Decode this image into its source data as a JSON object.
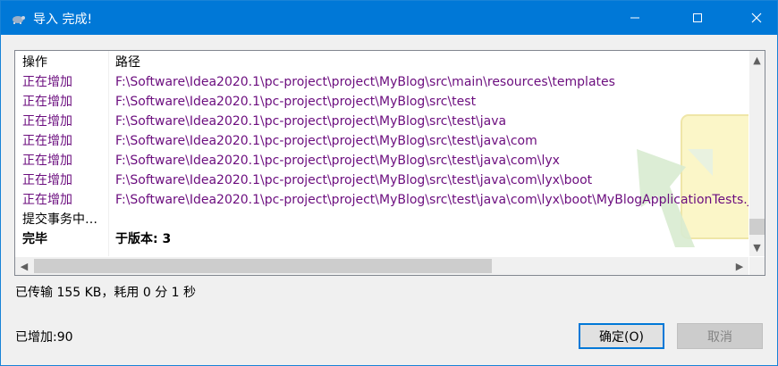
{
  "window": {
    "title": "导入 完成!"
  },
  "table": {
    "headers": {
      "action": "操作",
      "path": "路径"
    },
    "rows": [
      {
        "action": "正在增加",
        "path": "F:\\Software\\Idea2020.1\\pc-project\\project\\MyBlog\\src\\main\\resources\\templates",
        "style": "purple"
      },
      {
        "action": "正在增加",
        "path": "F:\\Software\\Idea2020.1\\pc-project\\project\\MyBlog\\src\\test",
        "style": "purple"
      },
      {
        "action": "正在增加",
        "path": "F:\\Software\\Idea2020.1\\pc-project\\project\\MyBlog\\src\\test\\java",
        "style": "purple"
      },
      {
        "action": "正在增加",
        "path": "F:\\Software\\Idea2020.1\\pc-project\\project\\MyBlog\\src\\test\\java\\com",
        "style": "purple"
      },
      {
        "action": "正在增加",
        "path": "F:\\Software\\Idea2020.1\\pc-project\\project\\MyBlog\\src\\test\\java\\com\\lyx",
        "style": "purple"
      },
      {
        "action": "正在增加",
        "path": "F:\\Software\\Idea2020.1\\pc-project\\project\\MyBlog\\src\\test\\java\\com\\lyx\\boot",
        "style": "purple"
      },
      {
        "action": "正在增加",
        "path": "F:\\Software\\Idea2020.1\\pc-project\\project\\MyBlog\\src\\test\\java\\com\\lyx\\boot\\MyBlogApplicationTests.java",
        "style": "purple"
      },
      {
        "action": "提交事务中…",
        "path": "",
        "style": "normal"
      },
      {
        "action": "完毕",
        "path": "于版本: 3",
        "style": "bold"
      }
    ]
  },
  "status": {
    "transfer": "已传输 155 KB，耗用 0 分 1 秒",
    "added": "已增加:90"
  },
  "buttons": {
    "ok": "确定(O)",
    "cancel": "取消"
  },
  "colors": {
    "titlebar": "#0078d7",
    "added_text": "#6b0d7e"
  }
}
